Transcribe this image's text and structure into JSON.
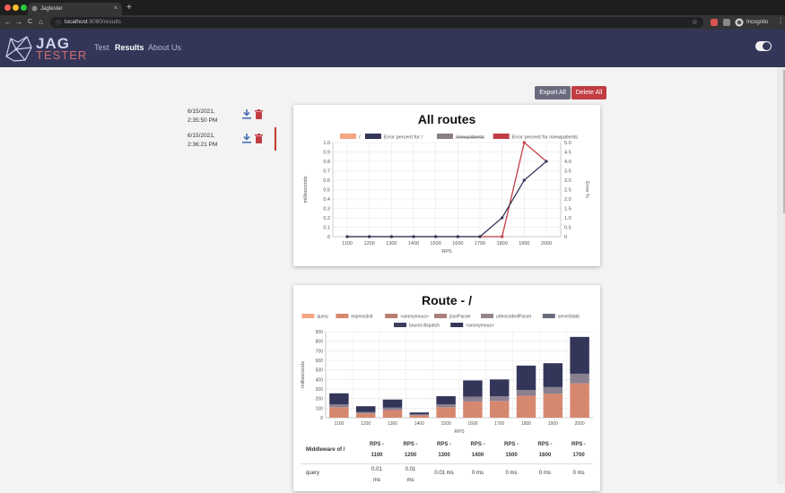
{
  "browser": {
    "tab_title": "Jagtester",
    "tab_close": "×",
    "new_tab": "+",
    "url_host": "localhost",
    "url_path": ":8080/results",
    "profile_label": "Incognito",
    "nav": {
      "back": "←",
      "forward": "→",
      "reload": "C",
      "home": "⌂",
      "star": "☆",
      "menu": "⋮"
    },
    "traffic_lights": [
      "#ff5f57",
      "#febc2e",
      "#28c840"
    ]
  },
  "app": {
    "logo_title": "JAG",
    "logo_sub": "TESTER",
    "nav": [
      "Test",
      "Results",
      "About Us"
    ],
    "active_nav": "Results",
    "colors": {
      "navbar": "#343659",
      "accent": "#c13d43",
      "export": "#6b6c7e"
    }
  },
  "actions": {
    "export_label": "Export All",
    "delete_label": "Delete All"
  },
  "history": [
    {
      "date": "6/15/2021,",
      "time": "2:35:50 PM"
    },
    {
      "date": "6/15/2021,",
      "time": "2:36:21 PM"
    }
  ],
  "icons": {
    "download": "download-icon",
    "trash": "trash-icon"
  },
  "chart_data": [
    {
      "type": "line",
      "title": "All routes",
      "legend": [
        {
          "name": "/",
          "color": "#f4a582",
          "struck": false
        },
        {
          "name": "Error percent for /",
          "color": "#343659",
          "struck": false
        },
        {
          "name": "/viewpatients",
          "color": "#8c7d87",
          "struck": true
        },
        {
          "name": "Error percent for /viewpatients",
          "color": "#c13d43",
          "struck": false
        }
      ],
      "xlabel": "RPS",
      "ylabel": "milliseconds",
      "y2label": "Error %",
      "x": [
        "1100",
        "1200",
        "1300",
        "1400",
        "1500",
        "1600",
        "1700",
        "1800",
        "1900",
        "2000"
      ],
      "ylim": [
        0,
        1.0
      ],
      "y2lim": [
        0,
        5.0
      ],
      "yticks": [
        "0",
        "0.1",
        "0.2",
        "0.3",
        "0.4",
        "0.5",
        "0.6",
        "0.7",
        "0.8",
        "0.9",
        "1.0"
      ],
      "y2ticks": [
        "0",
        "0.5",
        "1.0",
        "1.5",
        "2.0",
        "2.5",
        "3.0",
        "3.5",
        "4.0",
        "4.5",
        "5.0"
      ],
      "series": [
        {
          "name": "Error percent for /",
          "axis": "right",
          "color": "#343659",
          "values": [
            0,
            0,
            0,
            0,
            0,
            0,
            0,
            1.0,
            3.0,
            4.0
          ]
        },
        {
          "name": "Error percent for /viewpatients",
          "axis": "right",
          "color": "#c13d43",
          "values": [
            0,
            0,
            0,
            0,
            0,
            0,
            0,
            0,
            5.0,
            4.0
          ]
        }
      ],
      "grid": true
    },
    {
      "type": "bar",
      "stacked": true,
      "title": "Route - /",
      "legend": [
        {
          "name": "query",
          "color": "#f4a582"
        },
        {
          "name": "expressInit",
          "color": "#d6886f"
        },
        {
          "name": "<anonymous>",
          "color": "#b97f72"
        },
        {
          "name": "jsonParser",
          "color": "#a98079"
        },
        {
          "name": "urlencodedParser",
          "color": "#938589"
        },
        {
          "name": "serveStatic",
          "color": "#6b6c7e"
        },
        {
          "name": "bound dispatch",
          "color": "#3d3f60"
        },
        {
          "name": "<anonymous>",
          "color": "#343659"
        }
      ],
      "xlabel": "RPS",
      "ylabel": "milliseconds",
      "categories": [
        "1100",
        "1200",
        "1300",
        "1400",
        "1500",
        "1600",
        "1700",
        "1800",
        "1900",
        "2000"
      ],
      "ylim": [
        0,
        900
      ],
      "yticks": [
        "0",
        "100",
        "200",
        "300",
        "400",
        "500",
        "600",
        "700",
        "800",
        "900"
      ],
      "series": [
        {
          "name": "expressInit",
          "color": "#d6886f",
          "values": [
            110,
            45,
            80,
            25,
            110,
            170,
            175,
            230,
            250,
            360
          ]
        },
        {
          "name": "serveStatic",
          "color": "#8a8090",
          "values": [
            30,
            15,
            25,
            10,
            30,
            50,
            50,
            60,
            70,
            100
          ]
        },
        {
          "name": "<anonymous>",
          "color": "#343659",
          "values": [
            115,
            60,
            85,
            20,
            85,
            170,
            175,
            255,
            250,
            385
          ]
        }
      ],
      "grid": true
    }
  ],
  "table": {
    "header_label": "Middleware of /",
    "columns": [
      [
        "RPS -",
        "1100"
      ],
      [
        "RPS -",
        "1200"
      ],
      [
        "RPS -",
        "1300"
      ],
      [
        "RPS -",
        "1400"
      ],
      [
        "RPS -",
        "1500"
      ],
      [
        "RPS -",
        "1600"
      ],
      [
        "RPS -",
        "1700"
      ]
    ],
    "rows": [
      {
        "name": "query",
        "values": [
          [
            "0.01",
            "ms"
          ],
          [
            "0.01",
            "ms"
          ],
          [
            "0.01 ms"
          ],
          [
            "0 ms"
          ],
          [
            "0 ms"
          ],
          [
            "0 ms"
          ],
          [
            "0 ms"
          ]
        ]
      }
    ]
  }
}
